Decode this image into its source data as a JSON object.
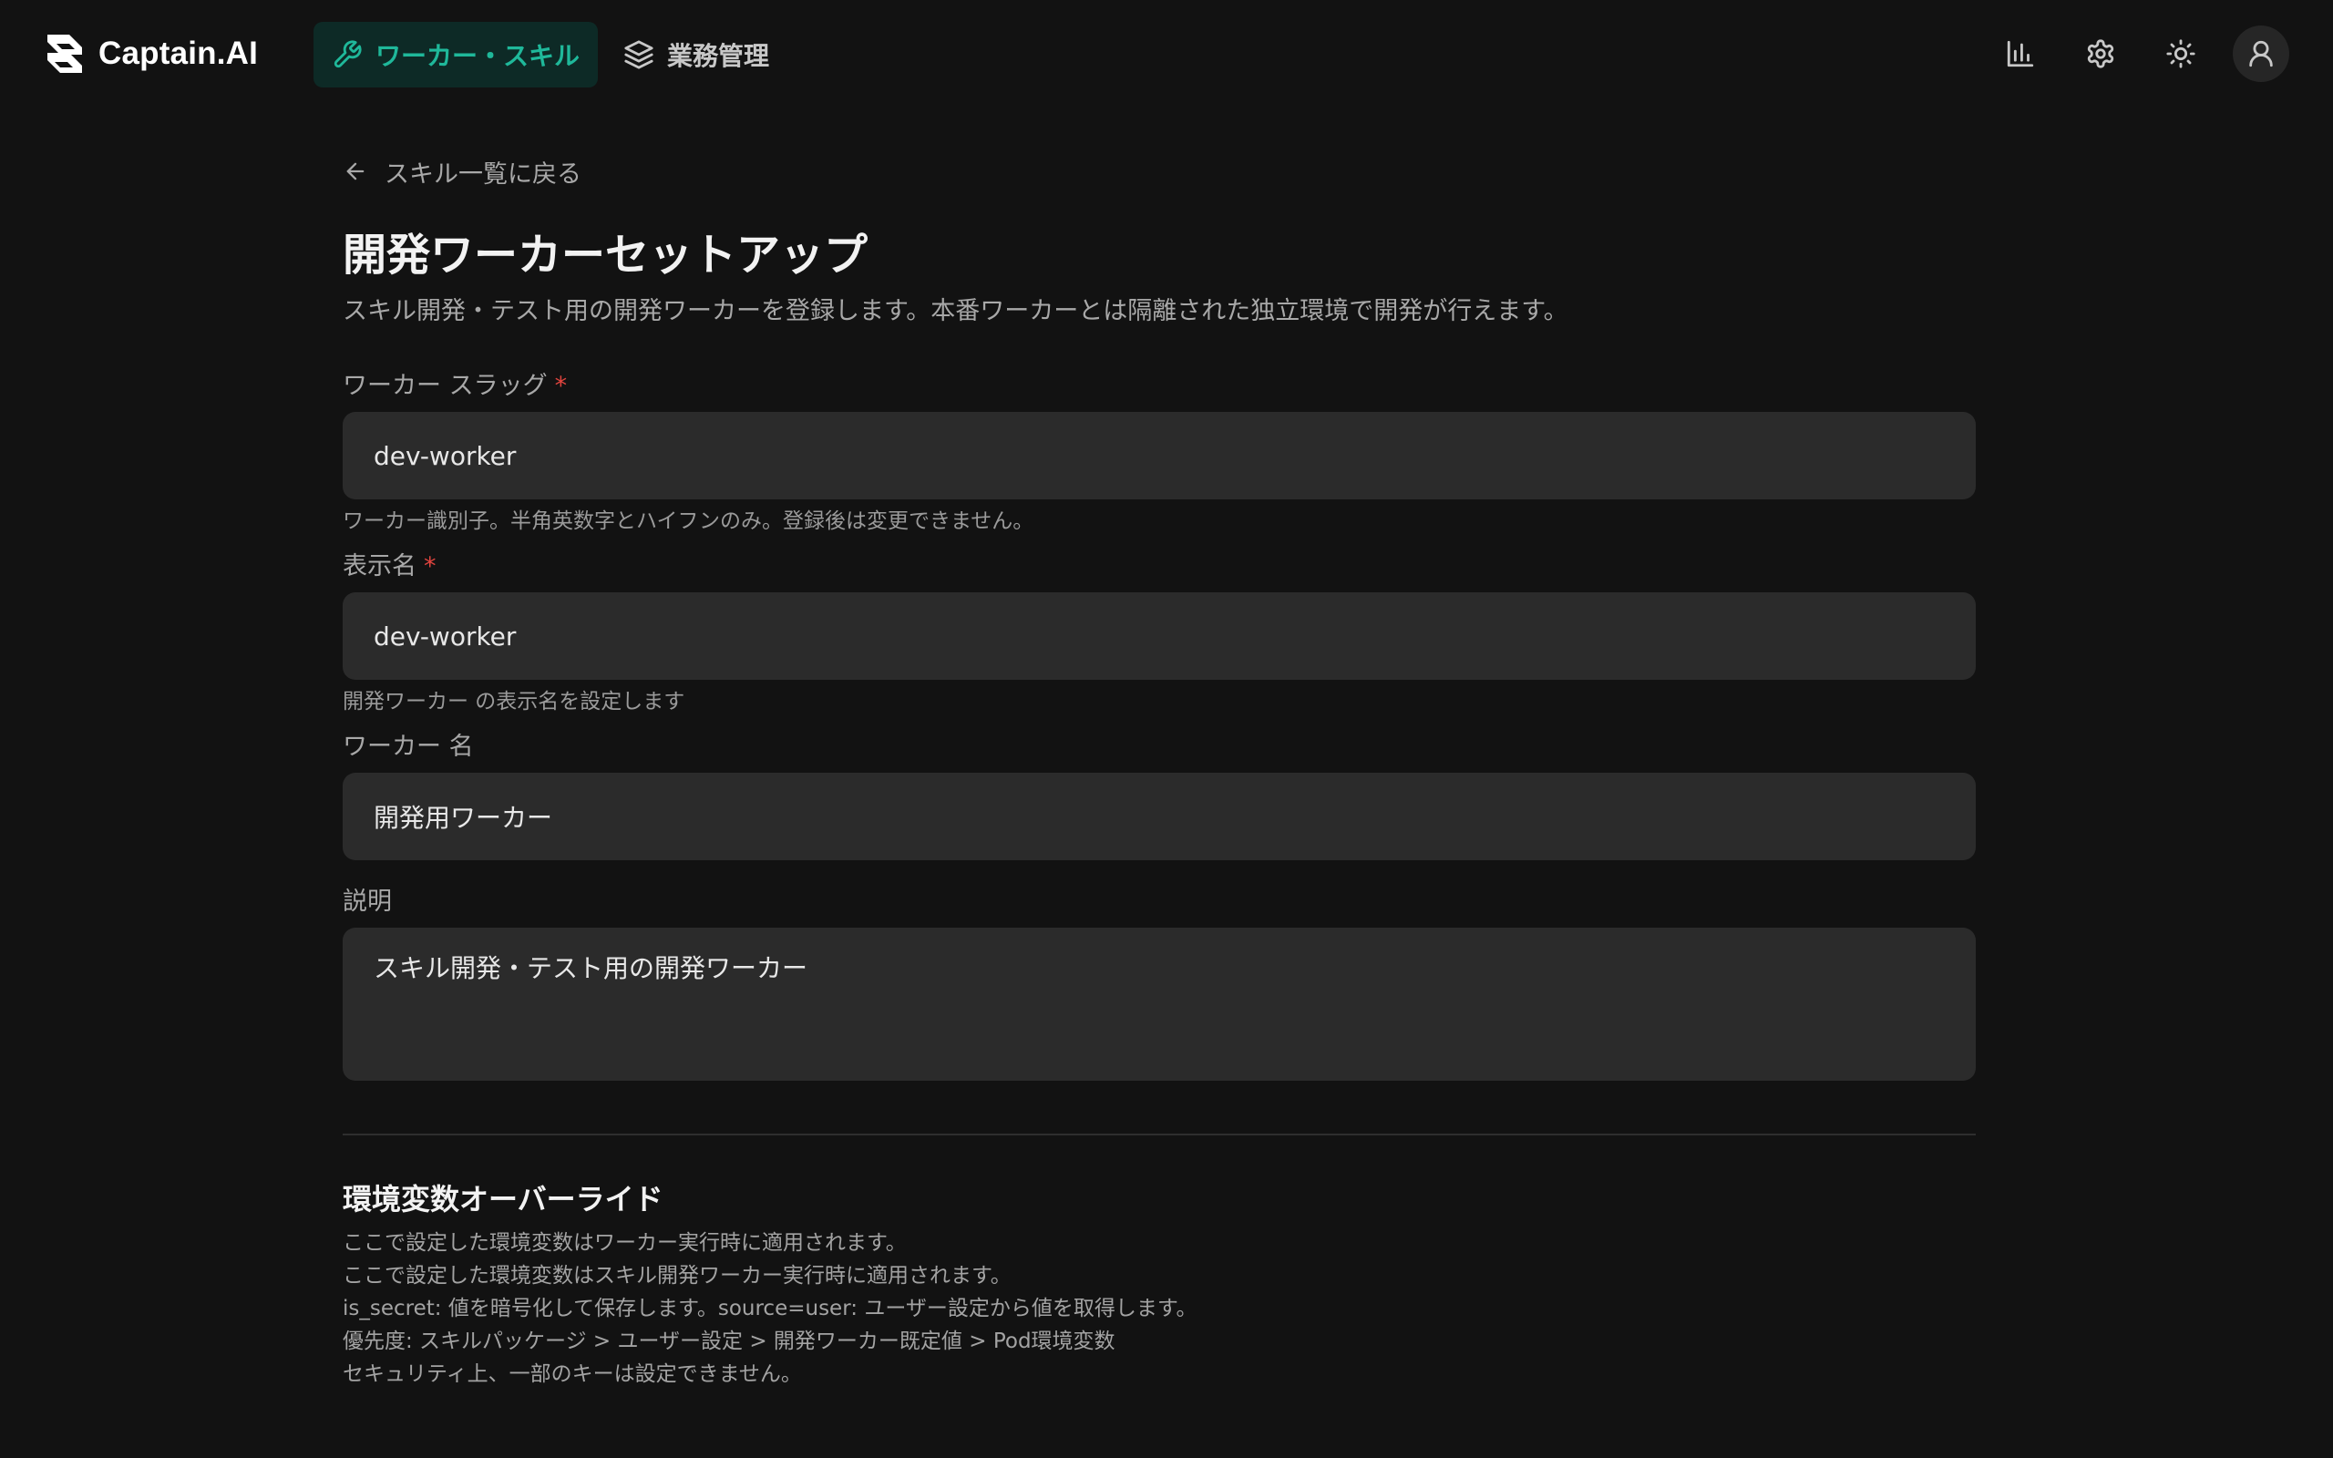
{
  "header": {
    "brand": "Captain.AI",
    "nav": [
      {
        "label": "ワーカー・スキル",
        "icon": "wrench-icon",
        "active": true
      },
      {
        "label": "業務管理",
        "icon": "layers-icon",
        "active": false
      }
    ],
    "actions": [
      "chart-icon",
      "gear-icon",
      "sun-icon",
      "user-icon"
    ]
  },
  "colors": {
    "accent": "#1fb89a",
    "required": "#e0443e",
    "background": "#121212",
    "field_bg": "#2b2b2b"
  },
  "back_link": "スキル一覧に戻る",
  "page": {
    "title": "開発ワーカーセットアップ",
    "subtitle": "スキル開発・テスト用の開発ワーカーを登録します。本番ワーカーとは隔離された独立環境で開発が行えます。"
  },
  "form": {
    "slug": {
      "label": "ワーカー スラッグ",
      "required_mark": "*",
      "value": "dev-worker",
      "hint": "ワーカー識別子。半角英数字とハイフンのみ。登録後は変更できません。"
    },
    "display_name": {
      "label": "表示名",
      "required_mark": "*",
      "value": "dev-worker",
      "hint": "開発ワーカー の表示名を設定します"
    },
    "worker_name": {
      "label": "ワーカー 名",
      "value": "開発用ワーカー"
    },
    "description": {
      "label": "説明",
      "value": "スキル開発・テスト用の開発ワーカー"
    }
  },
  "env_section": {
    "title": "環境変数オーバーライド",
    "lines": [
      "ここで設定した環境変数はワーカー実行時に適用されます。",
      "ここで設定した環境変数はスキル開発ワーカー実行時に適用されます。",
      "is_secret: 値を暗号化して保存します。source=user: ユーザー設定から値を取得します。",
      "優先度: スキルパッケージ > ユーザー設定 > 開発ワーカー既定値 > Pod環境変数",
      "セキュリティ上、一部のキーは設定できません。"
    ]
  }
}
